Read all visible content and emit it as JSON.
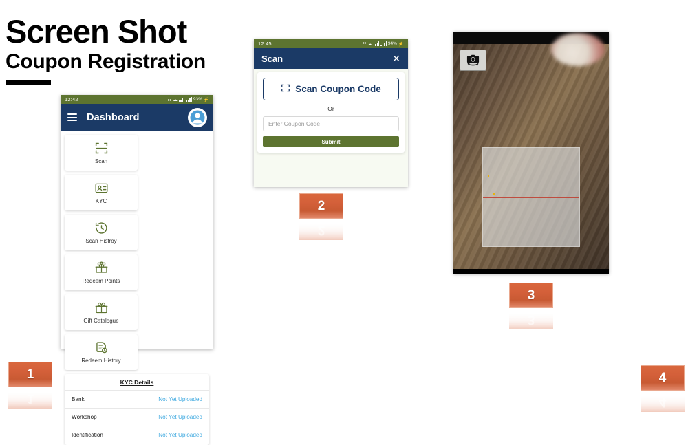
{
  "header": {
    "title_line1": "Screen Shot",
    "title_line2": "Coupon Registration"
  },
  "screens": [
    {
      "badge": "1",
      "name": "dashboard",
      "status_bar": {
        "time": "12:42",
        "battery": "93%"
      },
      "app_bar": {
        "title": "Dashboard",
        "menu_icon": "hamburger-menu-icon",
        "avatar_icon": "user-avatar-icon"
      },
      "tiles": [
        {
          "label": "Scan",
          "icon": "scan-frame-icon"
        },
        {
          "label": "KYC",
          "icon": "id-card-icon"
        },
        {
          "label": "Scan Histroy",
          "icon": "history-clock-icon"
        },
        {
          "label": "Redeem Points",
          "icon": "gift-stars-icon"
        },
        {
          "label": "Gift Catalogue",
          "icon": "gift-box-icon"
        },
        {
          "label": "Redeem History",
          "icon": "document-clock-icon"
        }
      ],
      "kyc": {
        "title": "KYC Details",
        "rows": [
          {
            "label": "Bank",
            "status": "Not Yet Uploaded"
          },
          {
            "label": "Workshop",
            "status": "Not Yet Uploaded"
          },
          {
            "label": "Identification",
            "status": "Not Yet Uploaded"
          }
        ]
      }
    },
    {
      "badge": "2",
      "name": "scan-coupon",
      "status_bar": {
        "time": "12:45",
        "battery": "94%"
      },
      "app_bar": {
        "title": "Scan",
        "close_icon": "close-x-icon"
      },
      "scan_button": {
        "label": "Scan Coupon Code",
        "icon": "scan-frame-icon"
      },
      "or_label": "Or",
      "coupon_input": {
        "value": "",
        "placeholder": "Enter Coupon Code"
      },
      "submit_button": "Submit"
    },
    {
      "badge": "3",
      "name": "camera-scanner",
      "switch_camera_icon": "switch-camera-icon"
    },
    {
      "badge": "4",
      "name": "step-four"
    }
  ],
  "colors": {
    "status_bar_green": "#5d7430",
    "app_bar_navy": "#1b3a66",
    "link_blue": "#3fa9e0",
    "badge_orange": "#d4603a",
    "submit_green": "#5d7430",
    "scan_line_red": "#c0392b"
  }
}
